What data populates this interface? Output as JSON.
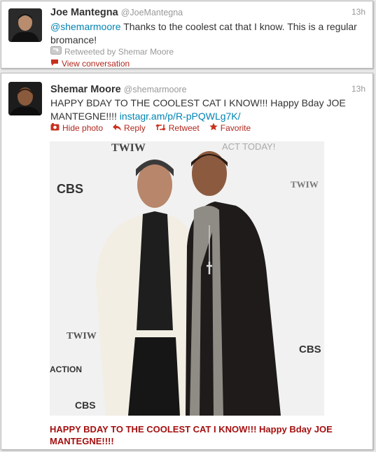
{
  "tweets": [
    {
      "name": "Joe Mantegna",
      "handle": "@JoeMantegna",
      "time": "13h",
      "mention": "@shemarmoore",
      "text": " Thanks to the coolest cat that I know. This is a regular bromance!",
      "retweeted_by": "Retweeted by Shemar Moore",
      "view_conversation": "View conversation",
      "icons": [
        "retweet-box-icon",
        "speech-bubble-icon"
      ]
    },
    {
      "name": "Shemar Moore",
      "handle": "@shemarmoore",
      "time": "13h",
      "text": "HAPPY BDAY TO THE COOLEST CAT I KNOW!!! Happy Bday JOE MANTEGNE!!!! ",
      "link": "instagr.am/p/R-pPQWLg7K/",
      "actions": {
        "hide_photo": "Hide photo",
        "reply": "Reply",
        "retweet": "Retweet",
        "favorite": "Favorite"
      },
      "photo_texts": {
        "twiw": "TWIW",
        "cbs": "CBS",
        "act_today": "ACT TODAY!",
        "action": "ACTION"
      },
      "caption": "HAPPY BDAY TO THE COOLEST CAT I KNOW!!! Happy Bday JOE MANTEGNE!!!!"
    }
  ],
  "colors": {
    "link": "#0084b4",
    "action_red": "#b0271e",
    "caption_red": "#a40f0f"
  }
}
